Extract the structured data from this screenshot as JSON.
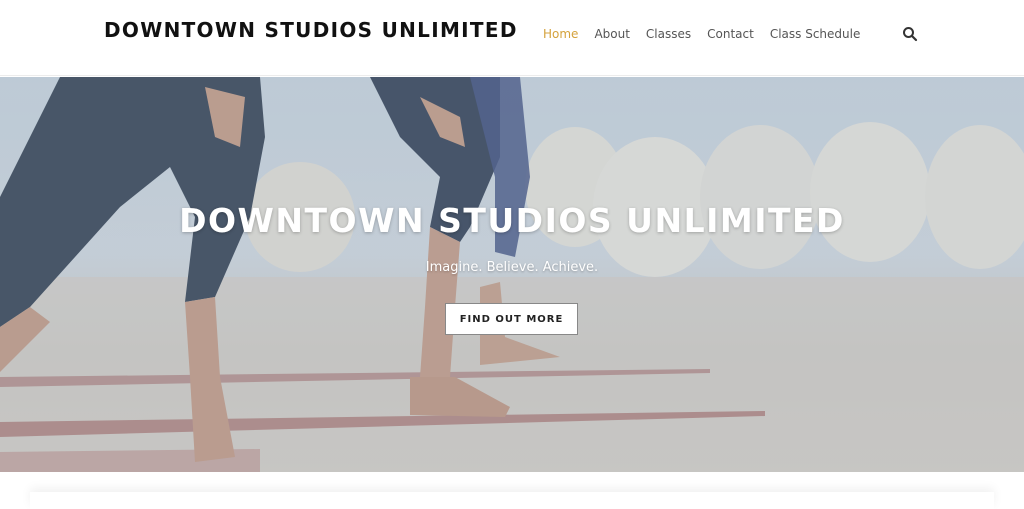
{
  "header": {
    "site_title": "DOWNTOWN STUDIOS UNLIMITED",
    "nav": [
      {
        "label": "Home",
        "active": true
      },
      {
        "label": "About",
        "active": false
      },
      {
        "label": "Classes",
        "active": false
      },
      {
        "label": "Contact",
        "active": false
      },
      {
        "label": "Class Schedule",
        "active": false
      }
    ],
    "search_icon": "search-icon"
  },
  "hero": {
    "title": "DOWNTOWN STUDIOS UNLIMITED",
    "tagline": "Imagine. Believe. Achieve.",
    "cta_label": "FIND OUT MORE",
    "background": "yoga-class-photo"
  },
  "colors": {
    "accent": "#d4a23c",
    "nav_text": "#555555",
    "title_text": "#111111"
  }
}
